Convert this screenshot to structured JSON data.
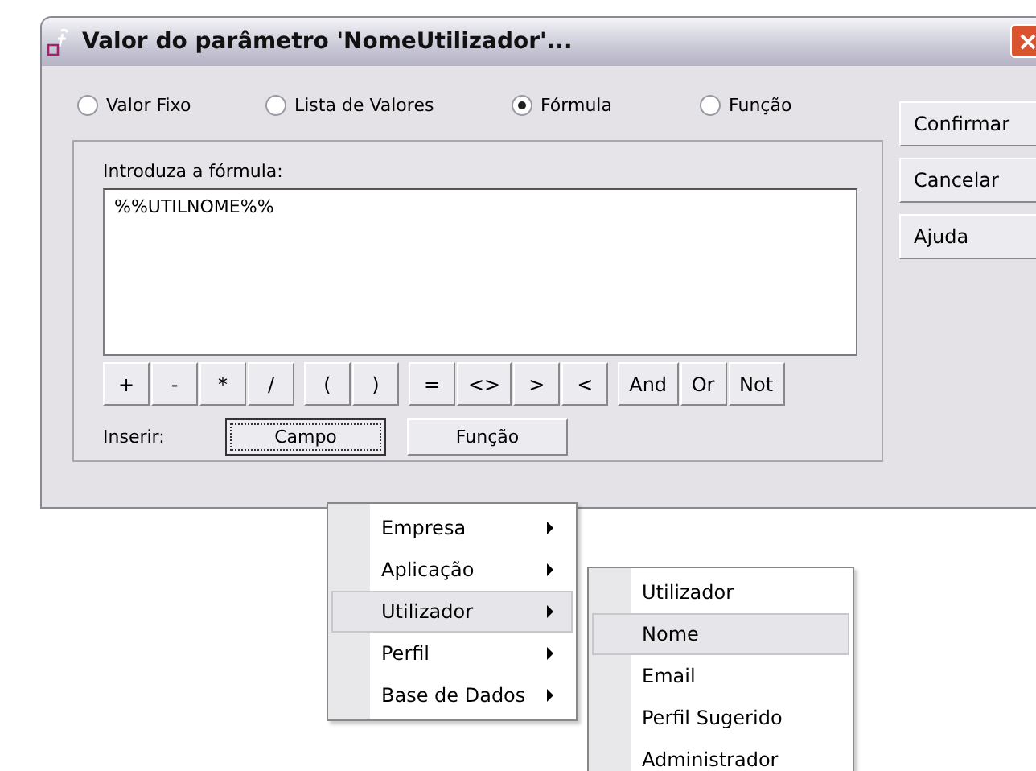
{
  "window": {
    "title": "Valor do parâmetro 'NomeUtilizador'..."
  },
  "modes": [
    {
      "label": "Valor Fixo",
      "selected": false
    },
    {
      "label": "Lista de Valores",
      "selected": false
    },
    {
      "label": "Fórmula",
      "selected": true
    },
    {
      "label": "Função",
      "selected": false
    }
  ],
  "actions": [
    "Confirmar",
    "Cancelar",
    "Ajuda"
  ],
  "formula": {
    "label": "Introduza a fórmula:",
    "value": "%%UTILNOME%%"
  },
  "operators": [
    [
      "+",
      "-",
      "*",
      "/"
    ],
    [
      "(",
      ")"
    ],
    [
      "=",
      "<>",
      ">",
      "<"
    ],
    [
      "And",
      "Or",
      "Not"
    ]
  ],
  "insert": {
    "label": "Inserir:",
    "buttons": [
      {
        "label": "Campo",
        "focused": true
      },
      {
        "label": "Função",
        "focused": false
      }
    ]
  },
  "menu": {
    "items": [
      {
        "label": "Empresa",
        "selected": false
      },
      {
        "label": "Aplicação",
        "selected": false
      },
      {
        "label": "Utilizador",
        "selected": true
      },
      {
        "label": "Perfil",
        "selected": false
      },
      {
        "label": "Base de Dados",
        "selected": false
      }
    ]
  },
  "submenu": {
    "items": [
      {
        "label": "Utilizador",
        "selected": false
      },
      {
        "label": "Nome",
        "selected": true
      },
      {
        "label": "Email",
        "selected": false
      },
      {
        "label": "Perfil Sugerido",
        "selected": false
      },
      {
        "label": "Administrador",
        "selected": false
      }
    ]
  }
}
